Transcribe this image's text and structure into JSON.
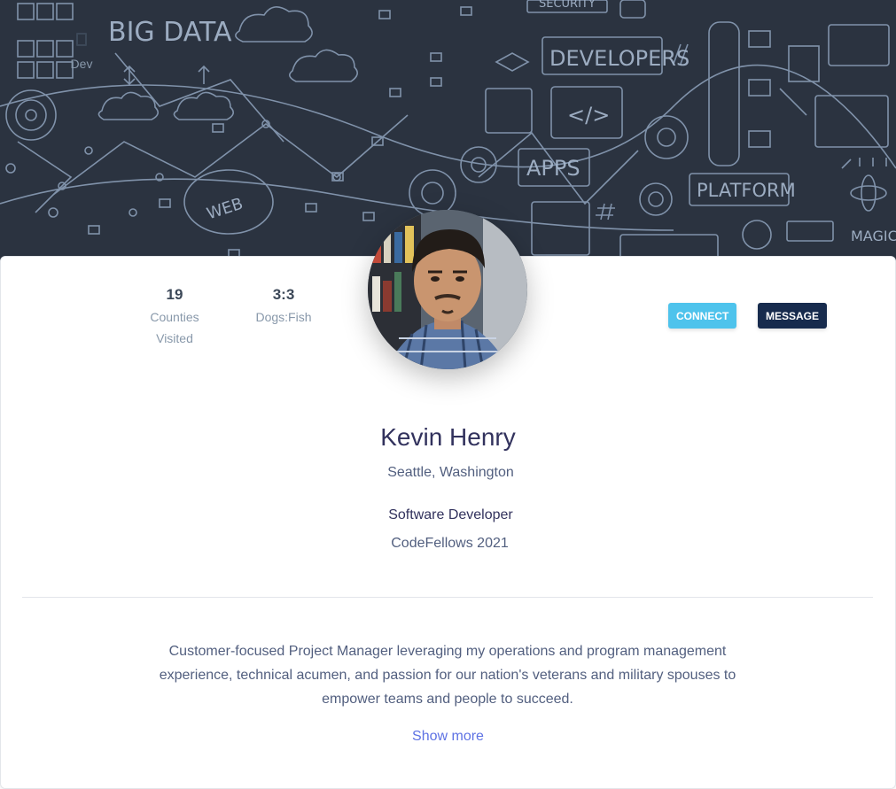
{
  "hero": {
    "doodle_words": [
      "BIG DATA",
      "SECURITY",
      "DEVELOPERS",
      "APPS",
      "PLATFORM",
      "WEB",
      "MAGIC"
    ],
    "background_color": "#2b3340"
  },
  "stats": [
    {
      "icon": "device-icon",
      "value": "",
      "label": "Dev"
    },
    {
      "value": "19",
      "label": "Counties Visited"
    },
    {
      "value": "3:3",
      "label": "Dogs:Fish"
    }
  ],
  "actions": {
    "connect_label": "CONNECT",
    "message_label": "MESSAGE",
    "connect_color": "#4ec3ec",
    "message_color": "#172b4d"
  },
  "profile": {
    "name": "Kevin Henry",
    "location": "Seattle, Washington",
    "title": "Software Developer",
    "school": "CodeFellows 2021"
  },
  "bio": {
    "text": "Customer-focused Project Manager leveraging my operations and program management experience, technical acumen, and passion for our nation's veterans and military spouses to empower teams and people to succeed.",
    "show_more_label": "Show more",
    "link_color": "#5e72e4"
  }
}
